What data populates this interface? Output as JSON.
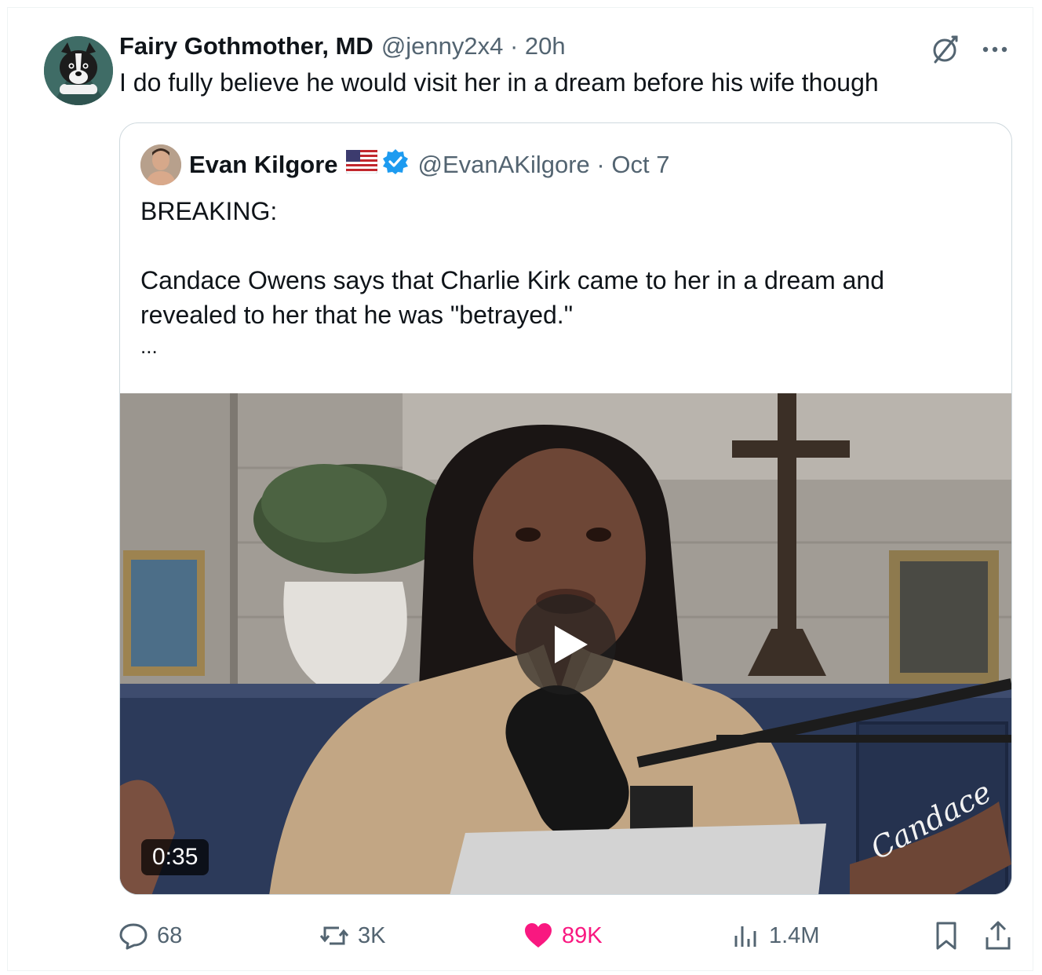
{
  "tweet": {
    "display_name": "Fairy Gothmother, MD",
    "handle_time": "@jenny2x4 · 20h",
    "text": "I do fully believe he would visit her in a dream before his wife though"
  },
  "quote": {
    "display_name": "Evan Kilgore",
    "flag_icon": "us-flag-icon",
    "verified_icon": "verified-badge-icon",
    "handle_time": "@EvanAKilgore · Oct 7",
    "line1": "BREAKING:",
    "line2": "Candace Owens says that Charlie Kirk came to her in a dream and",
    "line3": "revealed to her that he was \"betrayed.\"",
    "line4": "...",
    "video": {
      "duration": "0:35",
      "watermark": "Candace"
    }
  },
  "actions": {
    "replies": "68",
    "reposts": "3K",
    "likes": "89K",
    "views": "1.4M"
  },
  "colors": {
    "text": "#0f1419",
    "muted": "#536471",
    "like": "#f91880",
    "verified": "#1d9bf0",
    "border": "#cfd9de"
  }
}
